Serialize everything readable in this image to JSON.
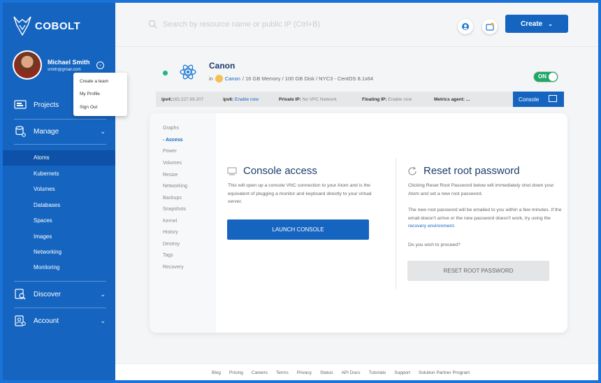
{
  "brand": {
    "name": "COBOLT"
  },
  "user": {
    "name": "Michael Smith",
    "email": "smith@gmail.com"
  },
  "user_menu": [
    "Create a team",
    "My Profile",
    "Sign Out"
  ],
  "sidebar": {
    "projects": "Projects",
    "manage": "Manage",
    "manage_items": [
      "Atoms",
      "Kubernets",
      "Volumes",
      "Databases",
      "Spaces",
      "Images",
      "Networking",
      "Monitoring"
    ],
    "discover": "Discover",
    "account": "Account"
  },
  "header": {
    "search_placeholder": "Search by resource name or public IP (Ctrl+B)",
    "create_label": "Create"
  },
  "droplet": {
    "name": "Canon",
    "in_label": "in",
    "project": "Canon",
    "specs": "/ 16 GB Memory / 100 GB Disk / NYC3 - CentOS 8.1x64",
    "power_label": "ON"
  },
  "infobar": {
    "ipv4_label": "ipv4:",
    "ipv4_value": "165.227.69.207",
    "ipv6_label": "ipv6:",
    "ipv6_value": "Enable now",
    "private_ip_label": "Private IP:",
    "private_ip_value": "No VPC Network",
    "floating_ip_label": "Floating IP:",
    "floating_ip_value": "Enable now",
    "metrics_label": "Metrics agent: ...",
    "console_label": "Console"
  },
  "subnav": [
    "Graphs",
    "- Access",
    "Power",
    "Volumes",
    "Resize",
    "Networking",
    "Backups",
    "Snapshots",
    "Kernel",
    "History",
    "Destroy",
    "Tags",
    "Recovery"
  ],
  "console_section": {
    "title": "Console access",
    "text": "This will open up a console VNC connection to your Atom and is the equivalent of plugging a monitor and keyboard directly to your virtual server.",
    "button": "LAUNCH CONSOLE"
  },
  "reset_section": {
    "title": "Reset root password",
    "text1": "Clicking Reset Root Password below will immediately shut down your Atom and set a new root password.",
    "text2_pre": "The new root password will be emailed to you within a few minutes. If the email doesn't arrive or the new password doesn't work, try using the",
    "text2_link": "recovery environment",
    "text2_post": ".",
    "text3": "Do you wish to proceed?",
    "button": "RESET ROOT PASSWORD"
  },
  "footer": [
    "Blog",
    "Pricing",
    "Careers",
    "Terms",
    "Privacy",
    "Status",
    "API Docs",
    "Tutorials",
    "Support",
    "Solution Partner Program"
  ]
}
